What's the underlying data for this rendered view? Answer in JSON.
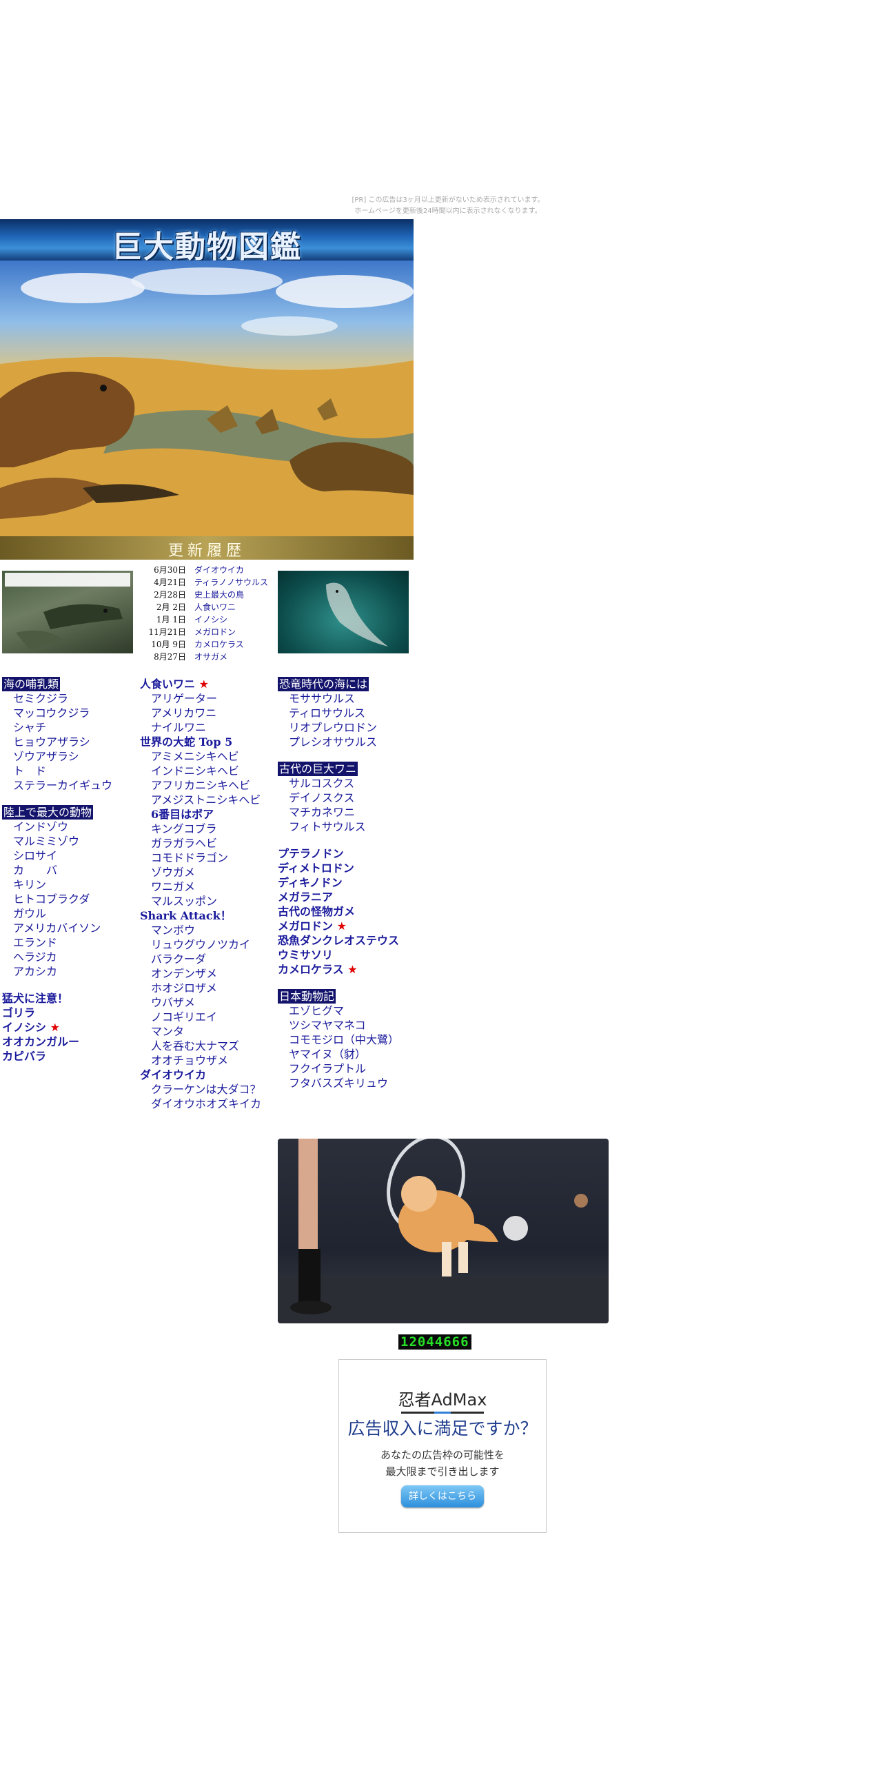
{
  "notice": {
    "line1": "[PR] この広告は3ヶ月以上更新がないため表示されています。",
    "line2": "ホームページを更新後24時間以内に表示されなくなります。"
  },
  "site": {
    "title": "巨大動物図鑑",
    "history_label": "更新履歴"
  },
  "updates": [
    {
      "date": "6月30日",
      "title": "ダイオウイカ"
    },
    {
      "date": "4月21日",
      "title": "ティラノノサウルス"
    },
    {
      "date": "2月28日",
      "title": "史上最大の鳥"
    },
    {
      "date": "2月  2日",
      "title": "人食いワニ"
    },
    {
      "date": "1月  1日",
      "title": "イノシシ"
    },
    {
      "date": "11月21日",
      "title": "メガロドン"
    },
    {
      "date": "10月  9日",
      "title": "カメロケラス"
    },
    {
      "date": "8月27日",
      "title": "オサガメ"
    }
  ],
  "col1": {
    "sea_head": "海の哺乳類",
    "sea_items": [
      "セミクジラ",
      "マッコウクジラ",
      "シャチ",
      "ヒョウアザラシ",
      "ゾウアザラシ",
      "ト　ド",
      "ステラーカイギュウ"
    ],
    "land_head": "陸上で最大の動物",
    "land_items": [
      "インドゾウ",
      "マルミミゾウ",
      "シロサイ",
      "カ　　バ",
      "キリン",
      "ヒトコブラクダ",
      "ガウル",
      "アメリカバイソン",
      "エランド",
      "ヘラジカ",
      "アカシカ"
    ],
    "bold_items": [
      "猛犬に注意！",
      "ゴリラ",
      "イノシシ",
      "オオカンガルー",
      "カピバラ"
    ]
  },
  "col2": {
    "croc_head": "人食いワニ",
    "croc_items": [
      "アリゲーター",
      "アメリカワニ",
      "ナイルワニ"
    ],
    "snake_head": "世界の大蛇 Top 5",
    "snake_items": [
      "アミメニシキヘビ",
      "インドニシキヘビ",
      "アフリカニシキヘビ",
      "アメジストニシキヘビ"
    ],
    "snake_sixth": "6番目はボア",
    "snake_items2": [
      "キングコブラ",
      "ガラガラヘビ",
      "コモドドラゴン",
      "ゾウガメ",
      "ワニガメ",
      "マルスッポン"
    ],
    "shark_head": "Shark Attack！",
    "shark_items": [
      "マンボウ",
      "リュウグウノツカイ",
      "バラクーダ",
      "オンデンザメ",
      "ホオジロザメ",
      "ウバザメ",
      "ノコギリエイ",
      "マンタ",
      "人を呑む大ナマズ",
      "オオチョウザメ"
    ],
    "squid_head": "ダイオウイカ",
    "squid_items": [
      "クラーケンは大ダコ？",
      "ダイオウホオズキイカ"
    ]
  },
  "col3": {
    "sea_dino_head": "恐竜時代の海には",
    "sea_dino_items": [
      "モササウルス",
      "ティロサウルス",
      "リオプレウロドン",
      "プレシオサウルス"
    ],
    "ancient_croc_head": "古代の巨大ワニ",
    "ancient_croc_items": [
      "サルコスクス",
      "デイノスクス",
      "マチカネワニ",
      "フィトサウルス"
    ],
    "bold_items": [
      "プテラノドン",
      "ディメトロドン",
      "ディキノドン",
      "メガラニア",
      "古代の怪物ガメ",
      "メガロドン",
      "恐魚ダンクレオステウス",
      "ウミサソリ",
      "カメロケラス"
    ],
    "japan_head": "日本動物記",
    "japan_items": [
      "エゾヒグマ",
      "ツシマヤマネコ",
      "コモモジロ（中大鷺）",
      "ヤマイヌ（豺）",
      "フクイラプトル",
      "フタバスズキリュウ"
    ]
  },
  "counter": "12044666",
  "ad": {
    "logo": "忍者AdMax",
    "headline": "広告収入に満足ですか？",
    "sub1": "あなたの広告枠の可能性を",
    "sub2": "最大限まで引き出します",
    "button": "詳しくはこちら"
  }
}
